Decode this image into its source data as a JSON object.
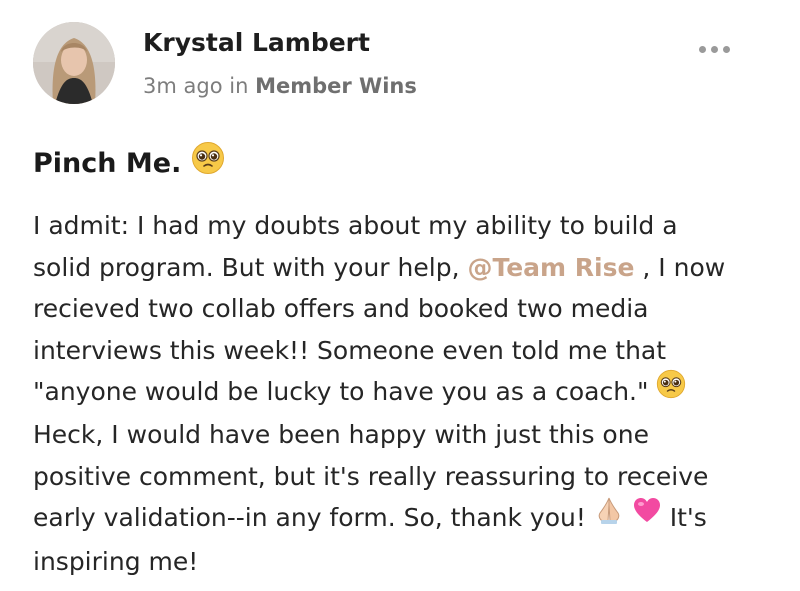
{
  "post": {
    "author": "Krystal Lambert",
    "time": "3m ago",
    "in_word": "in",
    "space": "Member Wins",
    "more_icon": "more-horizontal-icon",
    "title": "Pinch Me.",
    "mention": "@Team Rise",
    "lines": {
      "l1": "I admit: I had my doubts about my ability to build a",
      "l2a": "solid program. But with your help,",
      "l2b": ", I now",
      "l3": "recieved two collab offers and booked two media",
      "l4": "interviews this week!! Someone even told me that",
      "l5": "\"anyone would be lucky to have you as a coach.\"",
      "l6": "Heck, I would have been happy with just this one",
      "l7": "positive comment, but it's really reassuring to receive",
      "l8": "early validation--in any form. So, thank you!",
      "l8b": "It's",
      "l9": "inspiring me!"
    },
    "emojis": {
      "pleading": "pleading-face-emoji",
      "pray": "folded-hands-emoji",
      "heart": "pink-heart-emoji"
    }
  }
}
